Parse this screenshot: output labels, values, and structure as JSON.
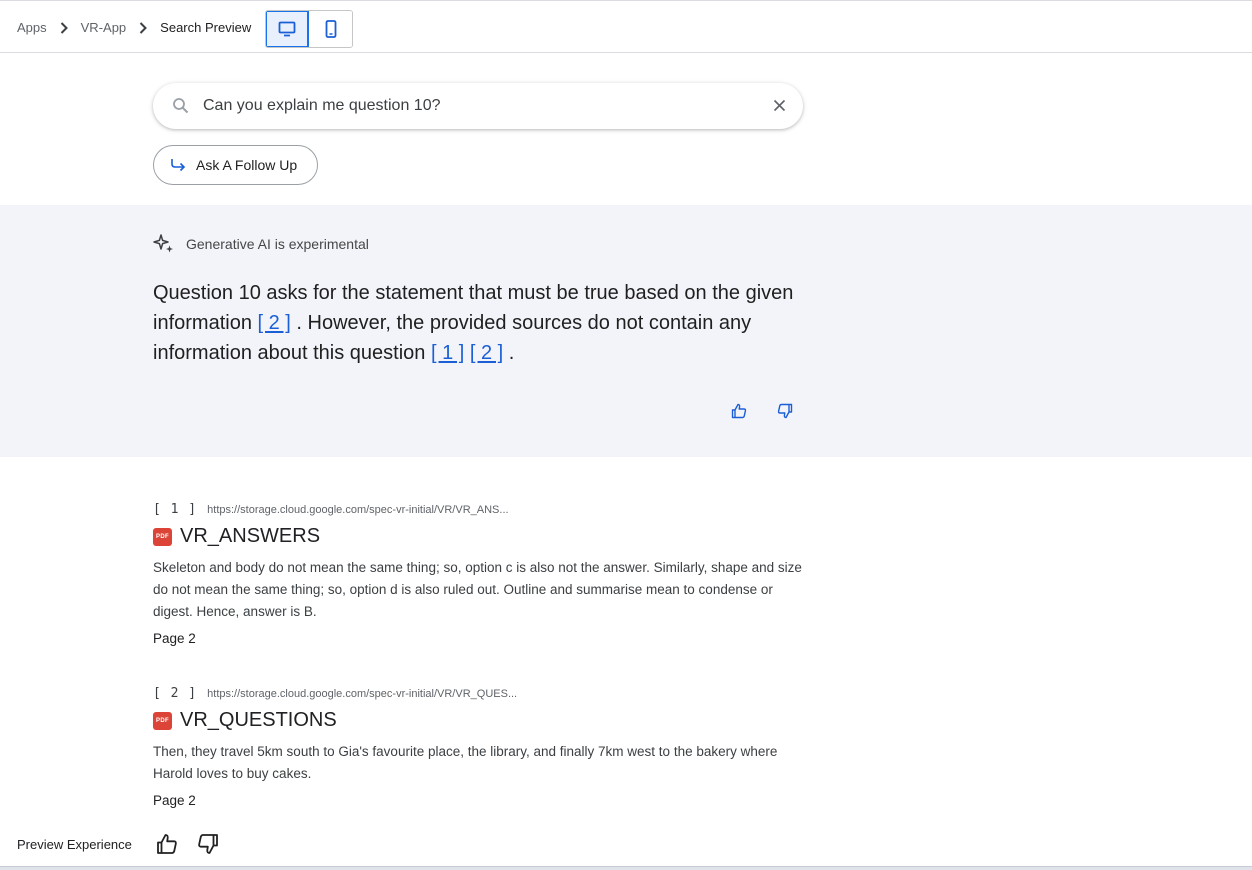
{
  "breadcrumb": {
    "items": [
      "Apps",
      "VR-App",
      "Search Preview"
    ]
  },
  "view_toggle": {
    "options": [
      {
        "icon": "desktop-icon",
        "active": true
      },
      {
        "icon": "mobile-icon",
        "active": false
      }
    ]
  },
  "search": {
    "query": "Can you explain me question 10?",
    "icon": "search-icon",
    "clear_icon": "close-icon"
  },
  "follow_up": {
    "label": "Ask A Follow Up",
    "icon": "follow-up-arrow-icon"
  },
  "ai_answer": {
    "badge": "Generative AI is experimental",
    "text_part1": "Question 10 asks for the statement that must be true based on the given information ",
    "cite_a": "[ 2 ]",
    "text_part2": " . However, the provided sources do not contain any information about this question ",
    "cite_b": "[ 1 ]",
    "cite_c": "[ 2 ]",
    "text_part3": " .",
    "accent_color": "#1a5fd6"
  },
  "sources": [
    {
      "index": "[ 1 ]",
      "url": "https://storage.cloud.google.com/spec-vr-initial/VR/VR_ANS...",
      "file_badge": "PDF",
      "title": "VR_ANSWERS",
      "snippet": "Skeleton and body do not mean the same thing; so, option c is also not the answer. Similarly, shape and size do not mean the same thing; so, option d is also ruled out. Outline and summarise mean to condense or digest. Hence, answer is B.",
      "page": "Page 2"
    },
    {
      "index": "[ 2 ]",
      "url": "https://storage.cloud.google.com/spec-vr-initial/VR/VR_QUES...",
      "file_badge": "PDF",
      "title": "VR_QUESTIONS",
      "snippet": "Then, they travel 5km south to Gia's favourite place, the library, and finally 7km west to the bakery where Harold loves to buy cakes.",
      "page": "Page 2"
    }
  ],
  "preview_bar": {
    "label": "Preview Experience"
  }
}
